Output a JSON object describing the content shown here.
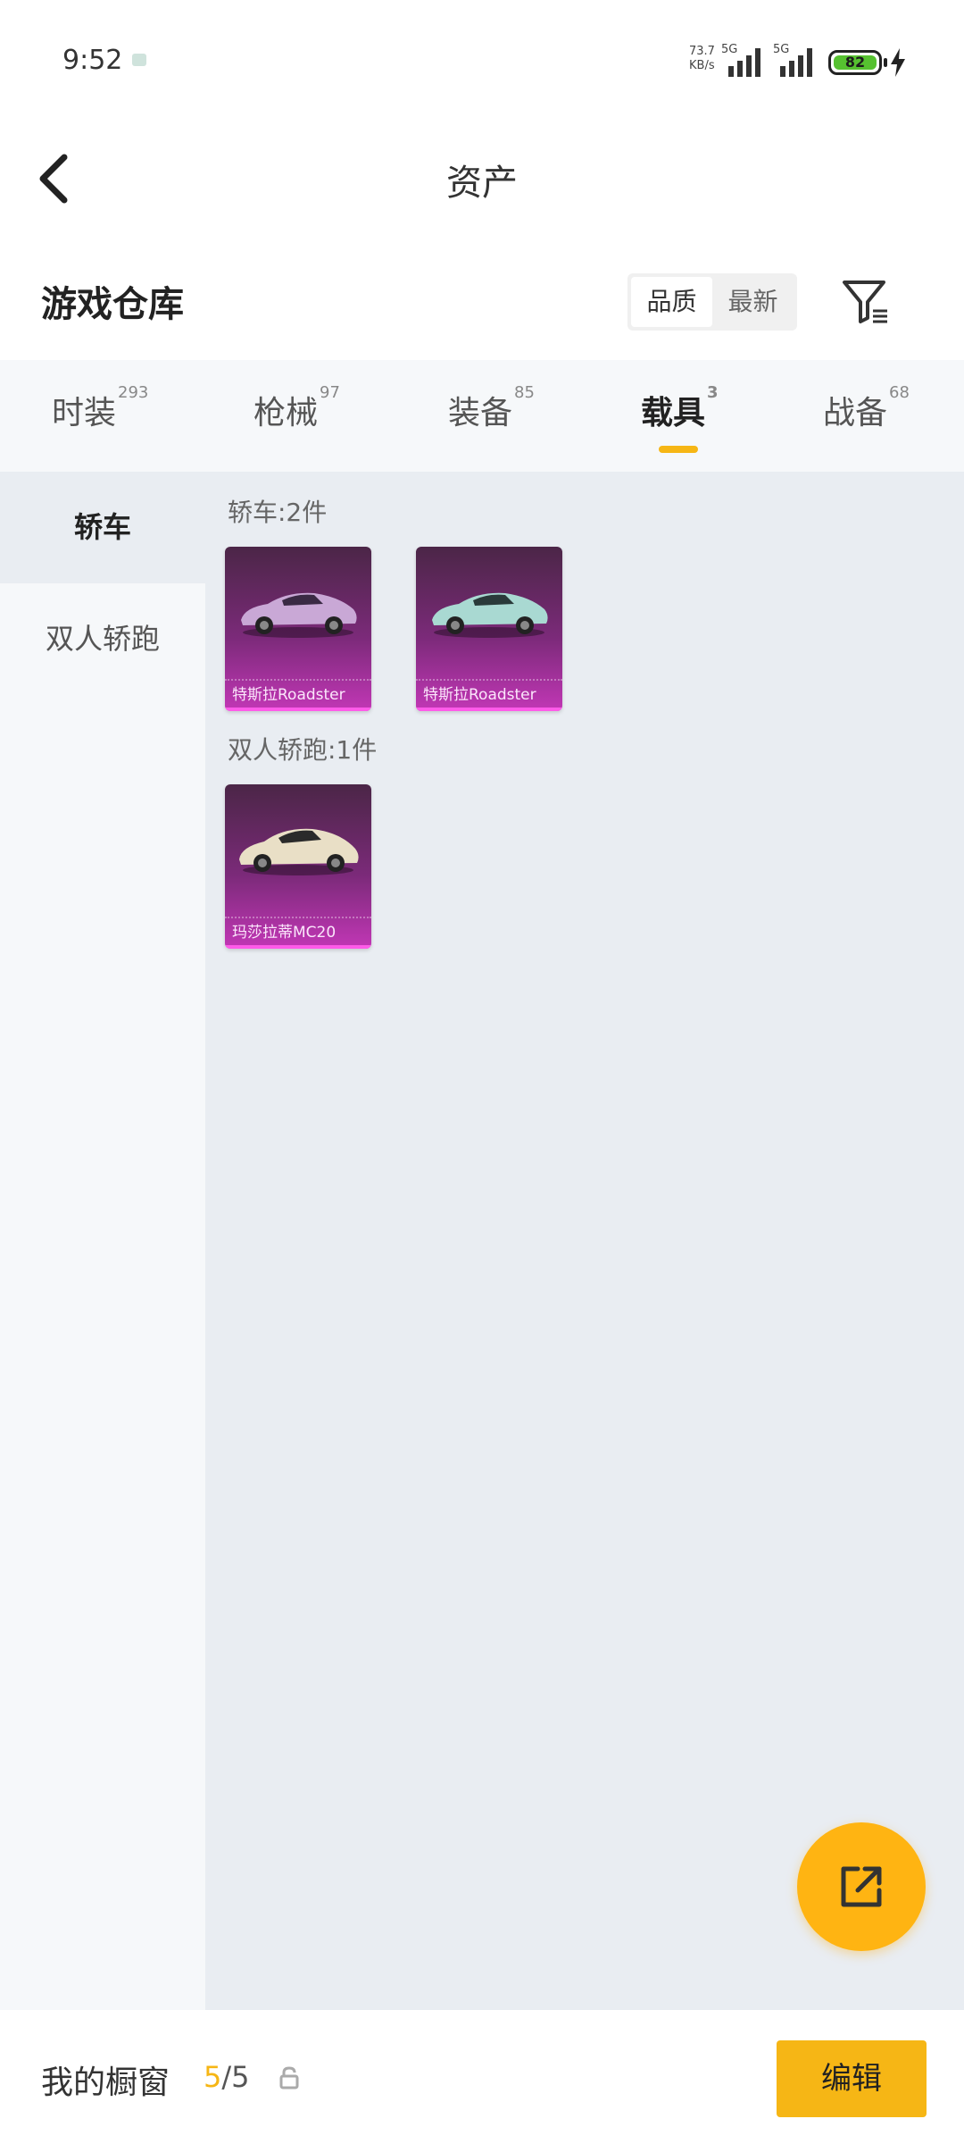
{
  "status_bar": {
    "time": "9:52",
    "net_speed_value": "73.7",
    "net_speed_unit": "KB/s",
    "signal_label_1": "5G",
    "signal_label_2": "5G",
    "battery": "82",
    "battery_color": "#56c130",
    "icons": [
      "notification-icon",
      "signal-icon",
      "signal-icon",
      "battery-icon",
      "charging-icon"
    ]
  },
  "header": {
    "title": "资产",
    "back_icon": "back-arrow-icon"
  },
  "warehouse": {
    "title": "游戏仓库",
    "sort_options": [
      "品质",
      "最新"
    ],
    "sort_selected": "品质",
    "filter_icon": "filter-icon"
  },
  "tabs": [
    {
      "label": "时装",
      "count": "293"
    },
    {
      "label": "枪械",
      "count": "97"
    },
    {
      "label": "装备",
      "count": "85"
    },
    {
      "label": "载具",
      "count": "3"
    },
    {
      "label": "战备",
      "count": "68"
    }
  ],
  "active_tab": "载具",
  "accent_color": "#f6b615",
  "sidebar": {
    "items": [
      "轿车",
      "双人轿跑"
    ],
    "selected": "轿车"
  },
  "groups": [
    {
      "label": "轿车:2件",
      "items": [
        {
          "name": "特斯拉Roadster",
          "car_color": "#c9a8d6"
        },
        {
          "name": "特斯拉Roadster",
          "car_color": "#a9d9d2"
        }
      ]
    },
    {
      "label": "双人轿跑:1件",
      "items": [
        {
          "name": "玛莎拉蒂MC20",
          "car_color": "#e9dfc6"
        }
      ]
    }
  ],
  "bottom_bar": {
    "showcase_label": "我的橱窗",
    "showcase_current": "5",
    "showcase_total": "/5",
    "lock_icon": "lock-icon",
    "edit_button": "编辑"
  },
  "fab_icon": "share-external-icon"
}
